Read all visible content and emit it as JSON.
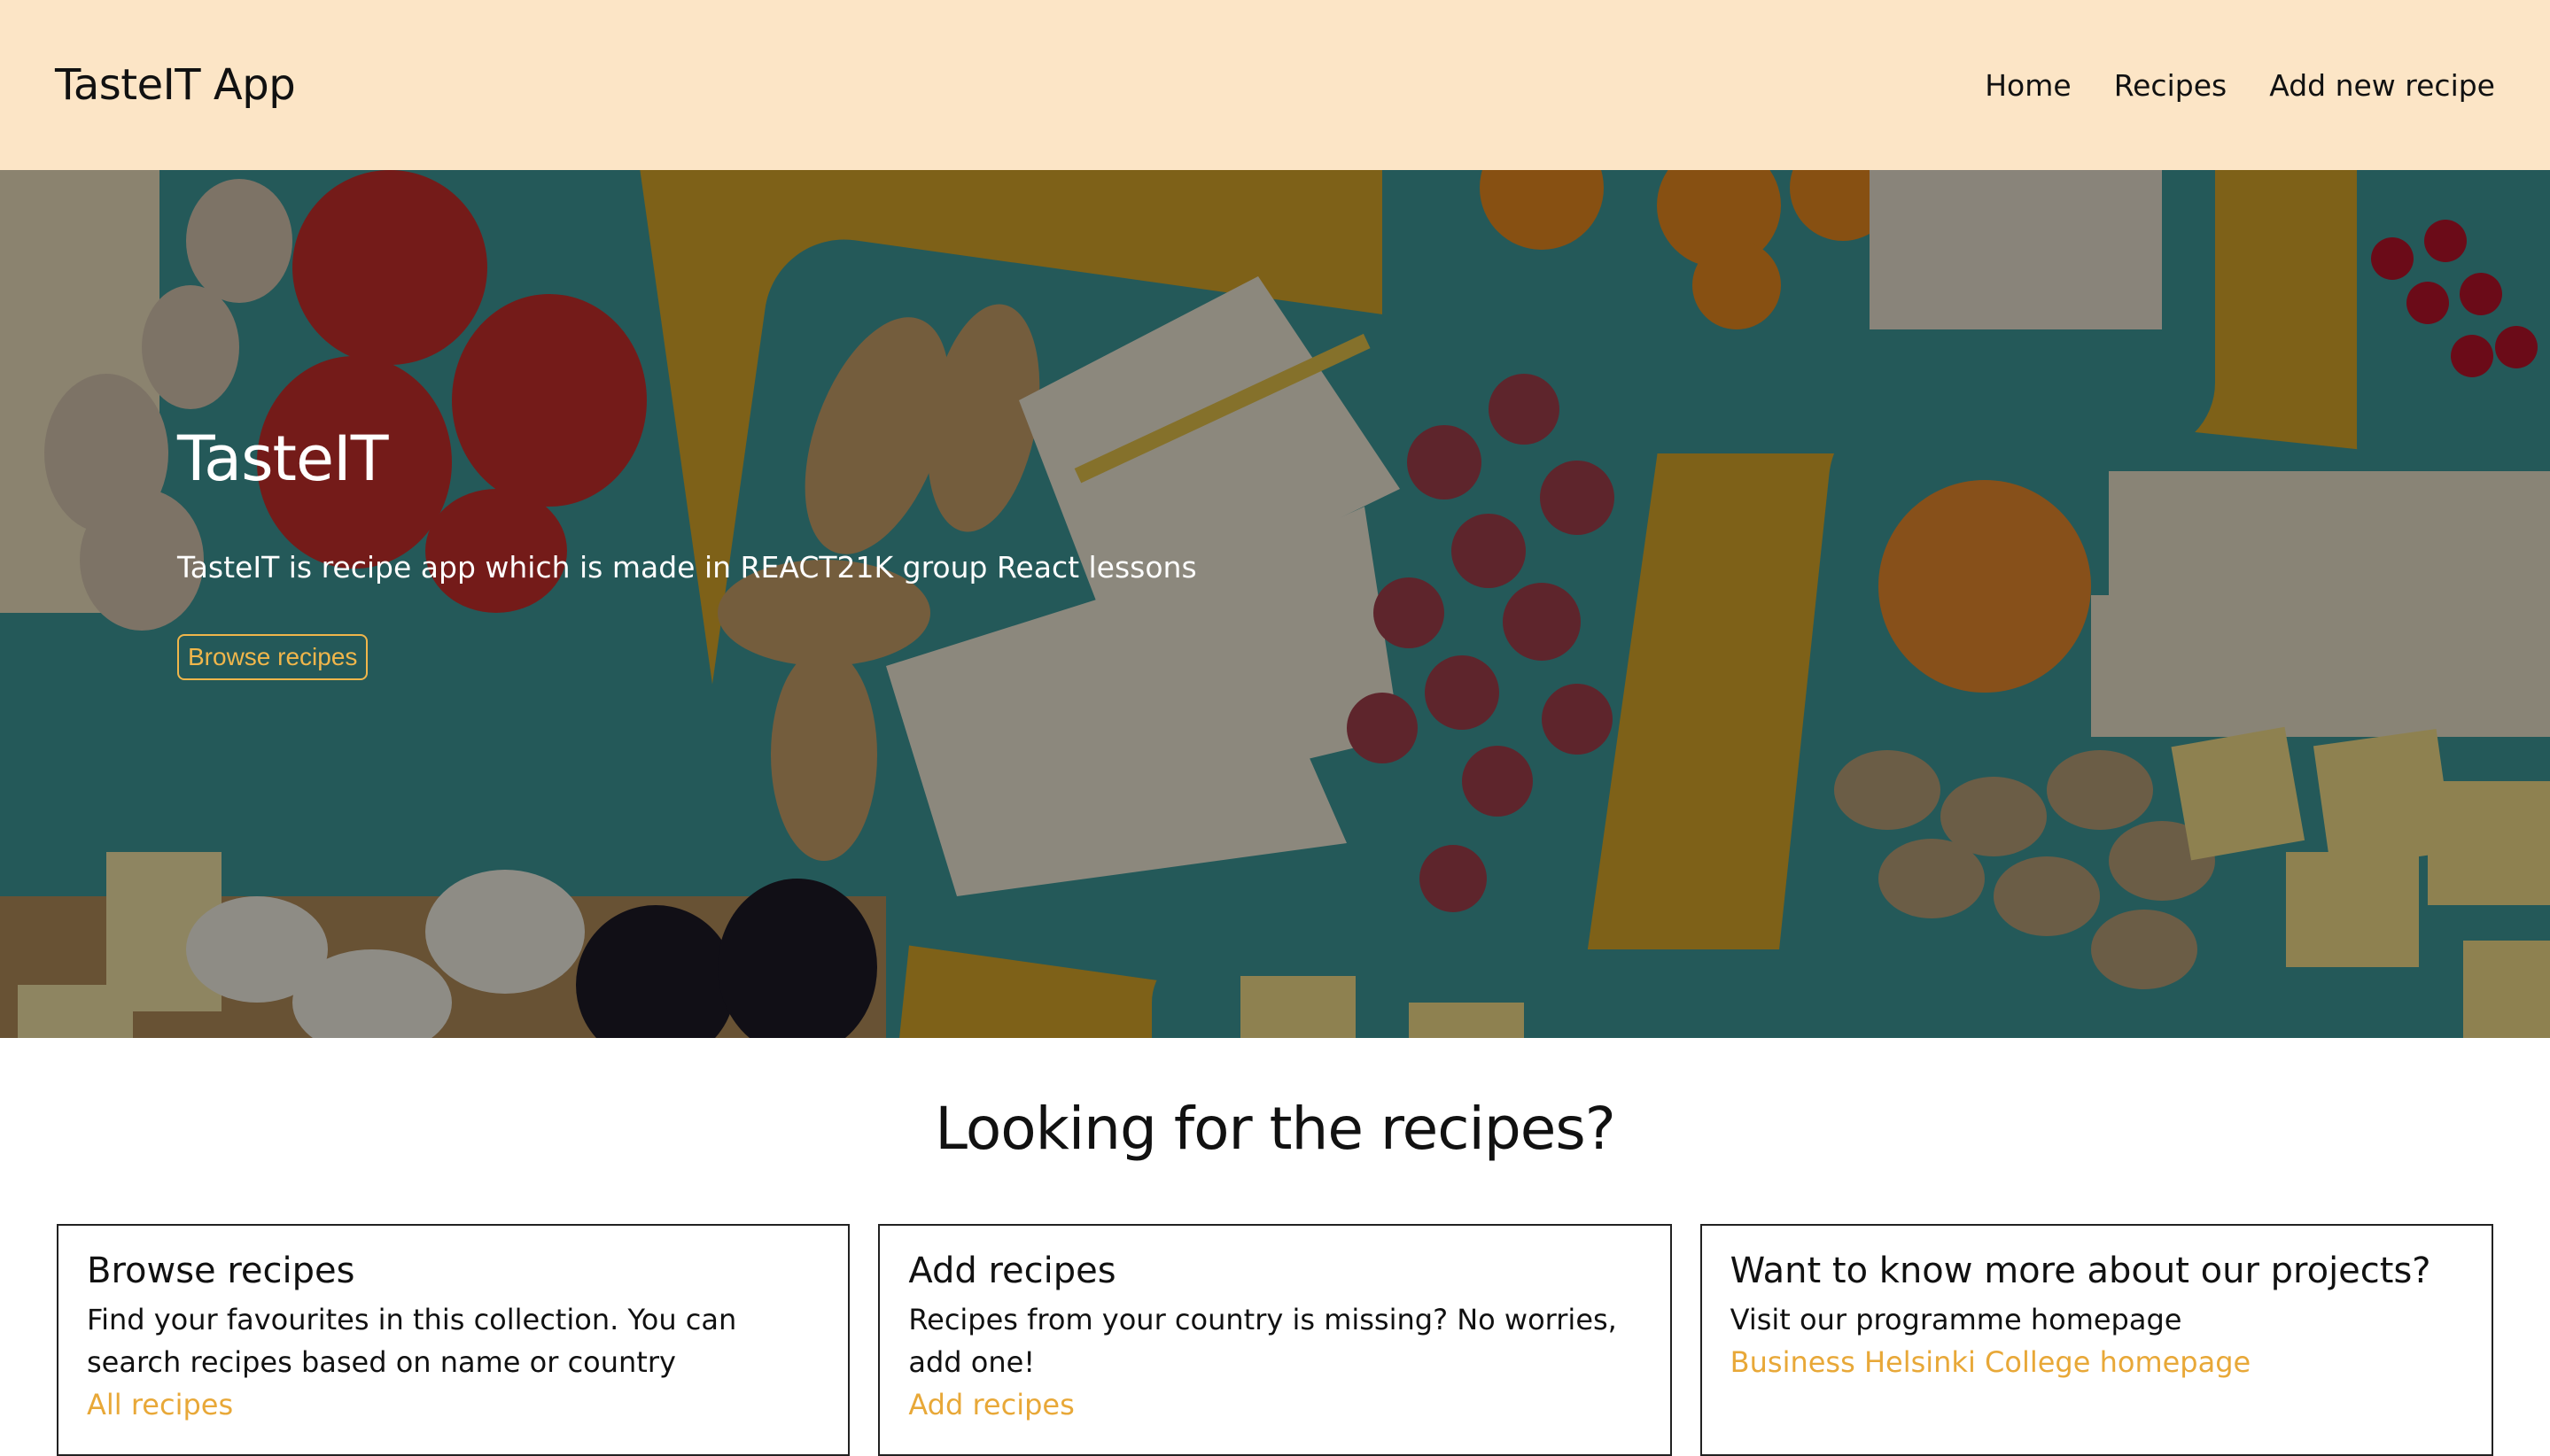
{
  "header": {
    "brand": "TasteIT App",
    "nav": [
      "Home",
      "Recipes",
      "Add new recipe"
    ]
  },
  "hero": {
    "title": "TasteIT",
    "description": "TasteIT is recipe app which is made in REACT21K group React lessons",
    "button_label": "Browse recipes"
  },
  "section": {
    "title": "Looking for the recipes?"
  },
  "cards": [
    {
      "title": "Browse recipes",
      "text": "Find your favourites in this collection. You can search recipes based on name or country",
      "link": "All recipes"
    },
    {
      "title": "Add recipes",
      "text": "Recipes from your country is missing? No worries, add one!",
      "link": "Add recipes"
    },
    {
      "title": "Want to know more about our projects?",
      "text": "Visit our programme homepage",
      "link": "Business Helsinki College homepage"
    }
  ],
  "colors": {
    "header_bg": "#fce5c6",
    "accent": "#e8a838",
    "hero_background": "#c79a22"
  }
}
